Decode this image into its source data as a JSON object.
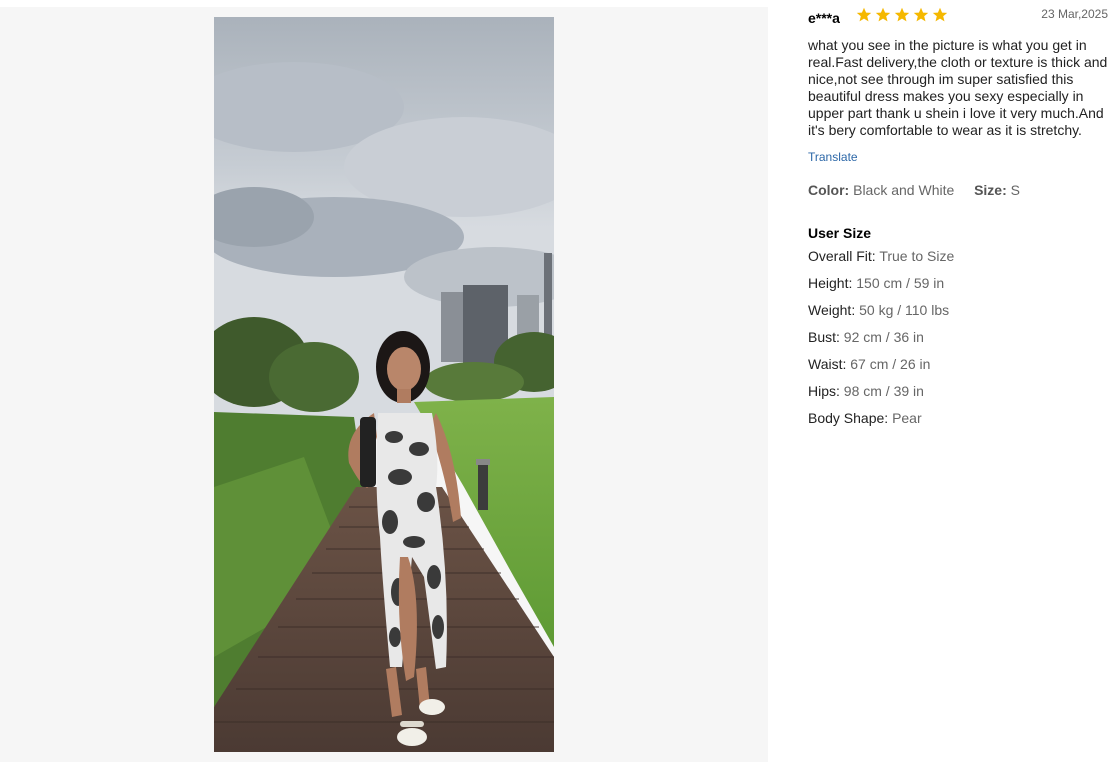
{
  "review": {
    "username": "e***a",
    "rating_stars": 5,
    "date": "23 Mar,2025",
    "text": "what you see in the picture is what you get in real.Fast delivery,the cloth or texture is thick and nice,not see through im super satisfied this beautiful dress makes you sexy especially in upper part thank u shein i love it very much.And it's bery comfortable to wear as it is stretchy.",
    "translate_label": "Translate",
    "color_label": "Color:",
    "color_value": "Black and White",
    "size_label": "Size:",
    "size_value": "S"
  },
  "user_size": {
    "title": "User Size",
    "rows": [
      {
        "label": "Overall Fit:",
        "value": "True to Size"
      },
      {
        "label": "Height:",
        "value": "150 cm / 59 in"
      },
      {
        "label": "Weight:",
        "value": "50 kg / 110 lbs"
      },
      {
        "label": "Bust:",
        "value": "92 cm / 36 in"
      },
      {
        "label": "Waist:",
        "value": "67 cm / 26 in"
      },
      {
        "label": "Hips:",
        "value": "98 cm / 39 in"
      },
      {
        "label": "Body Shape:",
        "value": "Pear"
      }
    ]
  },
  "colors": {
    "star": "#f5b800",
    "link": "#2d68a8",
    "gallery_bg": "#f6f6f6"
  },
  "icons": {
    "star": "star-icon"
  }
}
